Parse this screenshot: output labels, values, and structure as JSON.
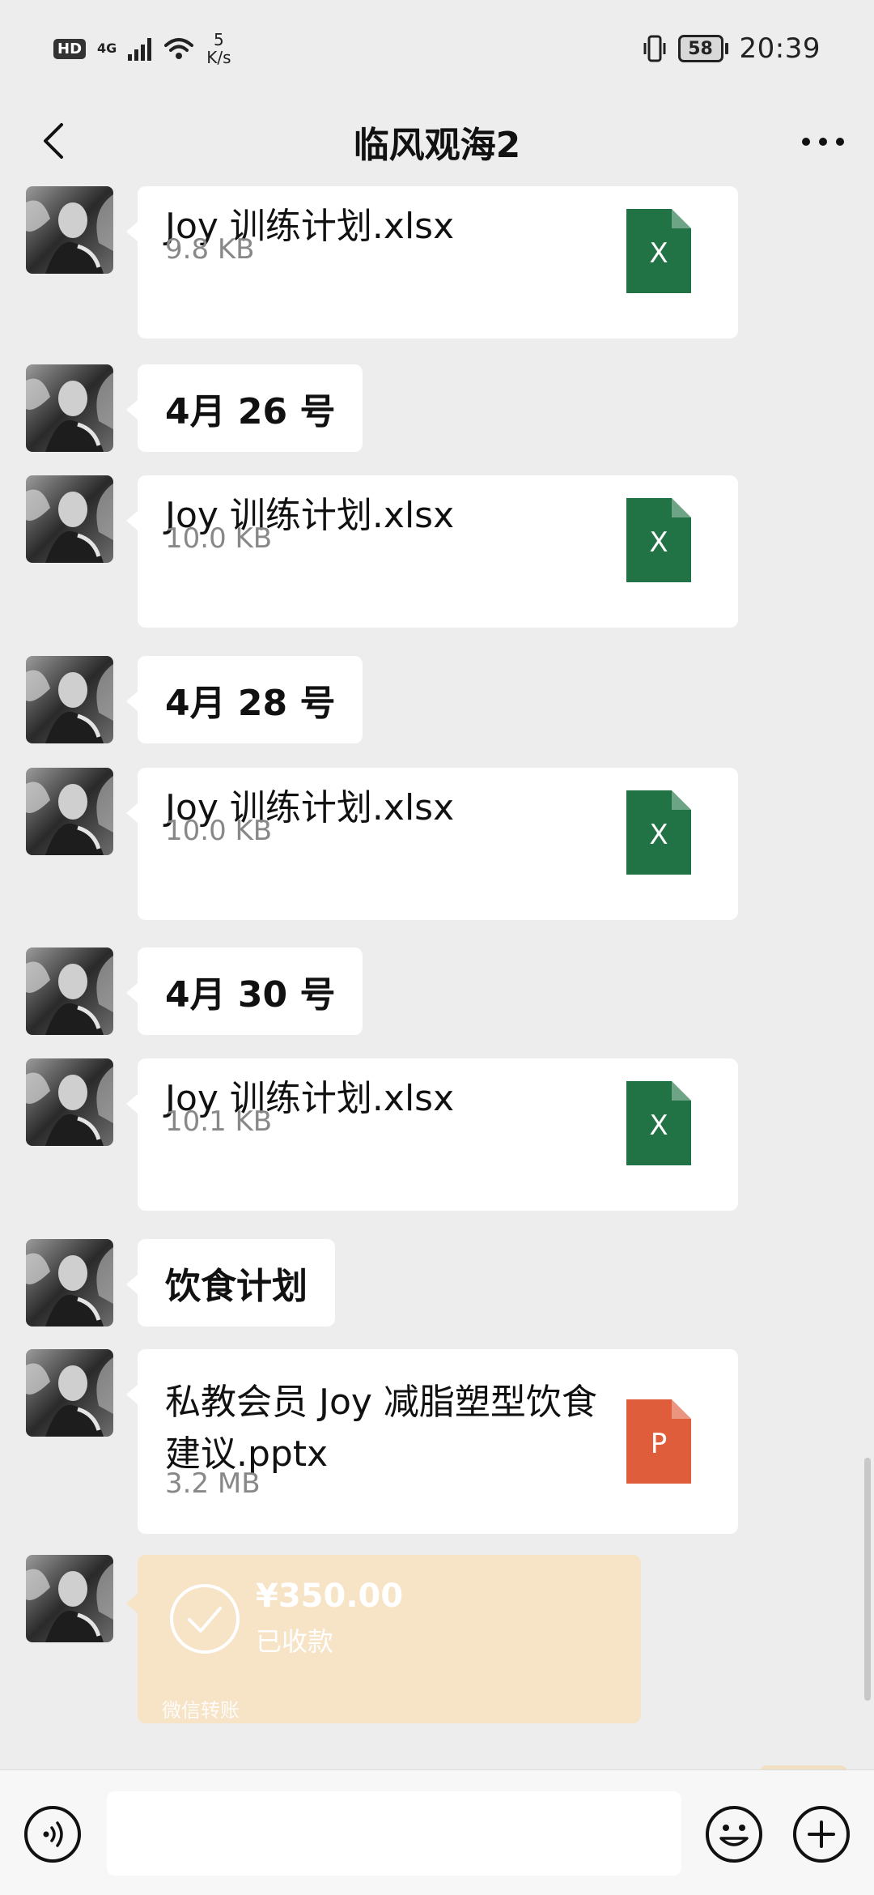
{
  "status_bar": {
    "hd": "HD",
    "network": "4G",
    "speed_value": "5",
    "speed_unit": "K/s",
    "battery": "58",
    "time": "20:39"
  },
  "header": {
    "title": "临风观海2",
    "back_icon": "chevron-left-icon",
    "more_icon": "more-dots-icon"
  },
  "messages": [
    {
      "type": "file",
      "name": "Joy 训练计划.xlsx",
      "size": "9.8 KB",
      "file_type": "excel"
    },
    {
      "type": "text",
      "text": "4月 26 号"
    },
    {
      "type": "file",
      "name": "Joy 训练计划.xlsx",
      "size": "10.0 KB",
      "file_type": "excel"
    },
    {
      "type": "text",
      "text": "4月 28 号"
    },
    {
      "type": "file",
      "name": "Joy 训练计划.xlsx",
      "size": "10.0 KB",
      "file_type": "excel"
    },
    {
      "type": "text",
      "text": "4月 30 号"
    },
    {
      "type": "file",
      "name": "Joy 训练计划.xlsx",
      "size": "10.1 KB",
      "file_type": "excel"
    },
    {
      "type": "text",
      "text": "饮食计划"
    },
    {
      "type": "file",
      "name": "私教会员 Joy 减脂塑型饮食建议.pptx",
      "size": "3.2 MB",
      "file_type": "powerpoint"
    },
    {
      "type": "transfer",
      "amount": "¥350.00",
      "status": "已收款",
      "footer": "微信转账"
    }
  ],
  "file_icons": {
    "excel_letter": "X",
    "excel_color": "#217346",
    "powerpoint_letter": "P",
    "powerpoint_color": "#e05d3c"
  },
  "input_bar": {
    "voice_icon": "voice-icon",
    "emoji_icon": "emoji-icon",
    "plus_icon": "plus-icon"
  }
}
